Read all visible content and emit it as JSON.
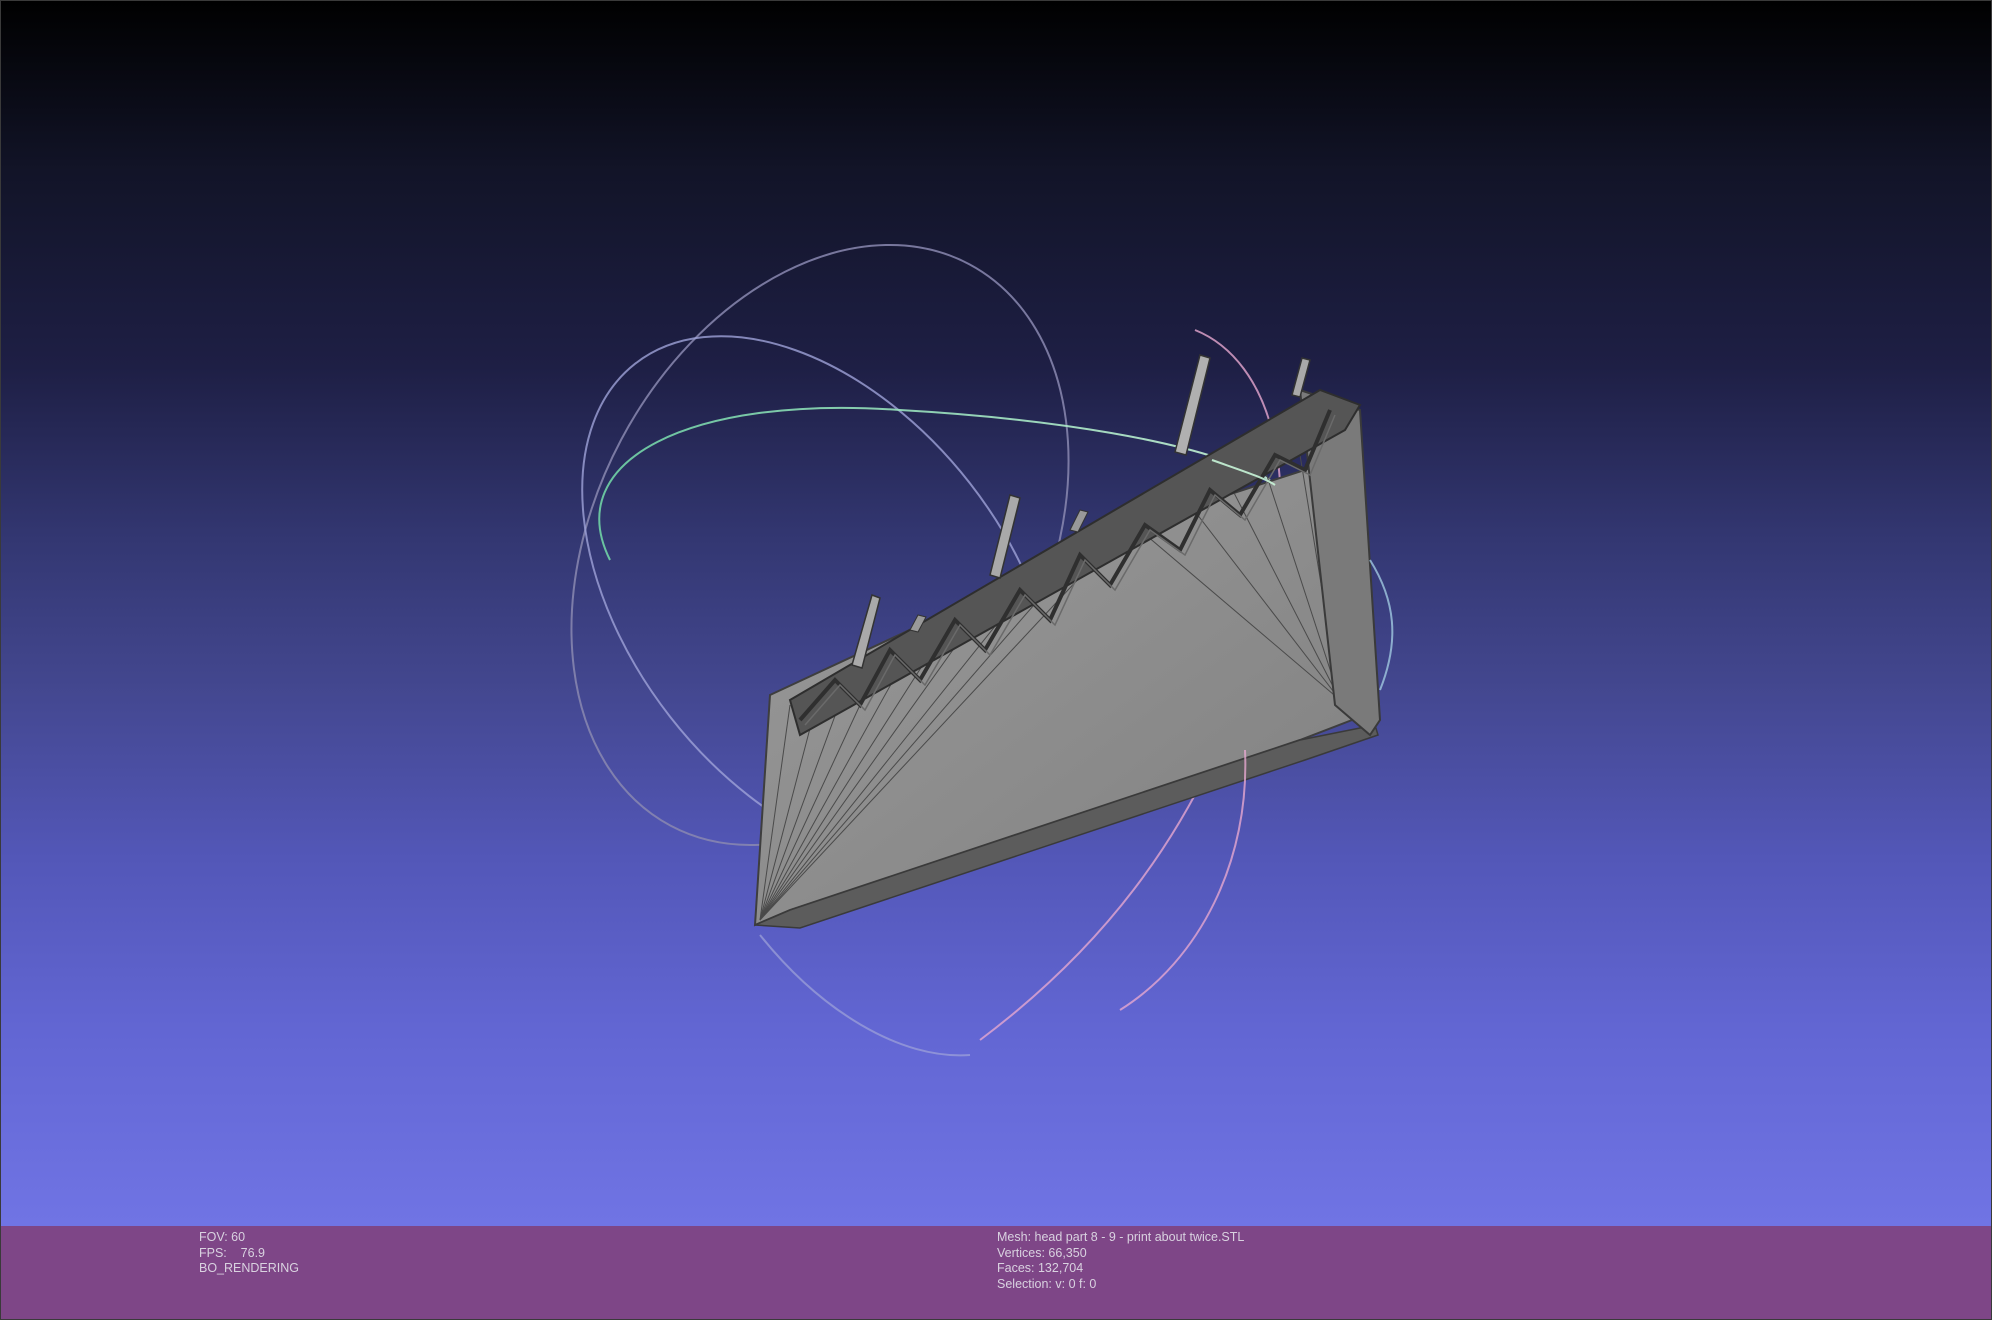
{
  "viewer": {
    "background_top": "#000000",
    "background_bottom": "#7074e4",
    "mesh_color": "#8c8c8c",
    "mesh_edge_color": "#3b3b3b",
    "trackball_colors": {
      "x_ring": "#e8a0c8",
      "y_ring": "#a0f0c0",
      "z_ring": "#c0c8ff"
    }
  },
  "status_left": {
    "fov": "FOV: 60",
    "fps": "FPS:    76.9",
    "mode": "BO_RENDERING"
  },
  "status_right": {
    "mesh": "Mesh: head part 8 - 9 - print about twice.STL",
    "vertices": "Vertices: 66,350",
    "faces": "Faces: 132,704",
    "selection": "Selection: v: 0 f: 0"
  },
  "status_bar_color": "#7e4687"
}
